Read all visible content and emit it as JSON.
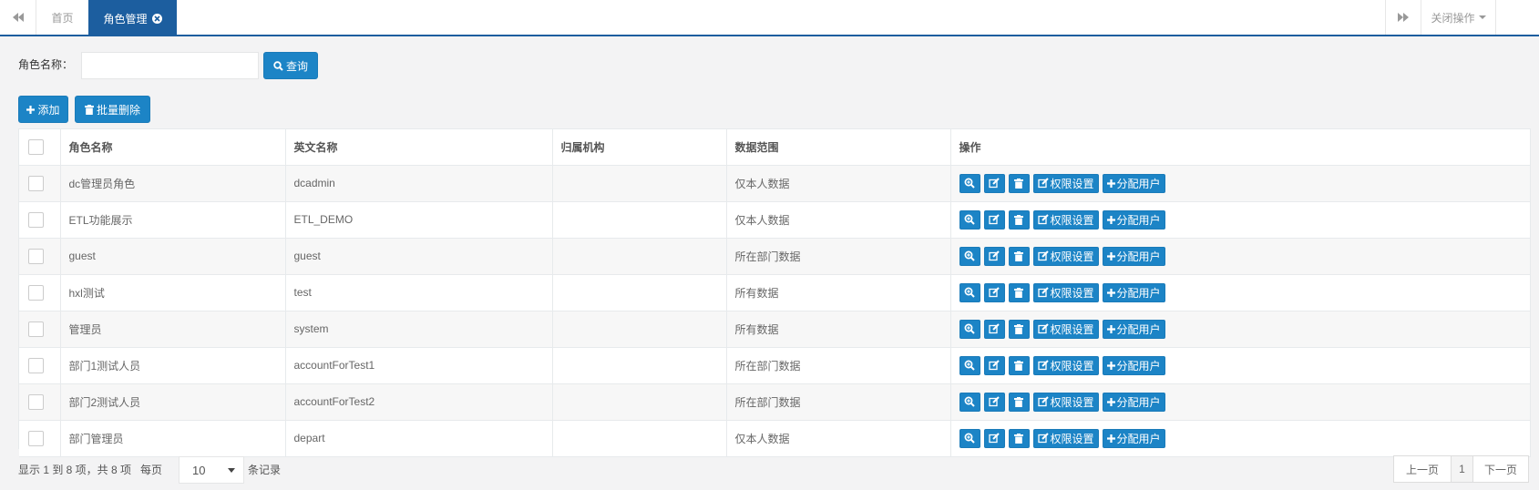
{
  "tabs": {
    "home_label": "首页",
    "active_label": "角色管理",
    "close_ops_label": "关闭操作"
  },
  "search": {
    "label": "角色名称：",
    "value": "",
    "placeholder": "",
    "button_label": "查询"
  },
  "toolbar": {
    "add_label": "添加",
    "batch_delete_label": "批量删除"
  },
  "table": {
    "columns": [
      "角色名称",
      "英文名称",
      "归属机构",
      "数据范围",
      "操作"
    ],
    "rows": [
      {
        "name": "dc管理员角色",
        "en_name": "dcadmin",
        "org": "",
        "scope": "仅本人数据"
      },
      {
        "name": "ETL功能展示",
        "en_name": "ETL_DEMO",
        "org": "",
        "scope": "仅本人数据"
      },
      {
        "name": "guest",
        "en_name": "guest",
        "org": "",
        "scope": "所在部门数据"
      },
      {
        "name": "hxl测试",
        "en_name": "test",
        "org": "",
        "scope": "所有数据"
      },
      {
        "name": "管理员",
        "en_name": "system",
        "org": "",
        "scope": "所有数据"
      },
      {
        "name": "部门1测试人员",
        "en_name": "accountForTest1",
        "org": "",
        "scope": "所在部门数据"
      },
      {
        "name": "部门2测试人员",
        "en_name": "accountForTest2",
        "org": "",
        "scope": "所在部门数据"
      },
      {
        "name": "部门管理员",
        "en_name": "depart",
        "org": "",
        "scope": "仅本人数据"
      }
    ],
    "row_actions": {
      "view_icon": "zoom-in-icon",
      "edit_icon": "edit-icon",
      "delete_icon": "trash-icon",
      "permission_label": "权限设置",
      "assign_label": "分配用户"
    }
  },
  "footer": {
    "info": "显示 1 到 8 项，共 8 项",
    "per_page_label": "每页",
    "page_size": "10",
    "suffix": "条记录",
    "prev_label": "上一页",
    "current_page": "1",
    "next_label": "下一页"
  },
  "colors": {
    "primary": "#1c84c6",
    "active_tab": "#1c5e9f",
    "background": "#f3f3f4"
  }
}
